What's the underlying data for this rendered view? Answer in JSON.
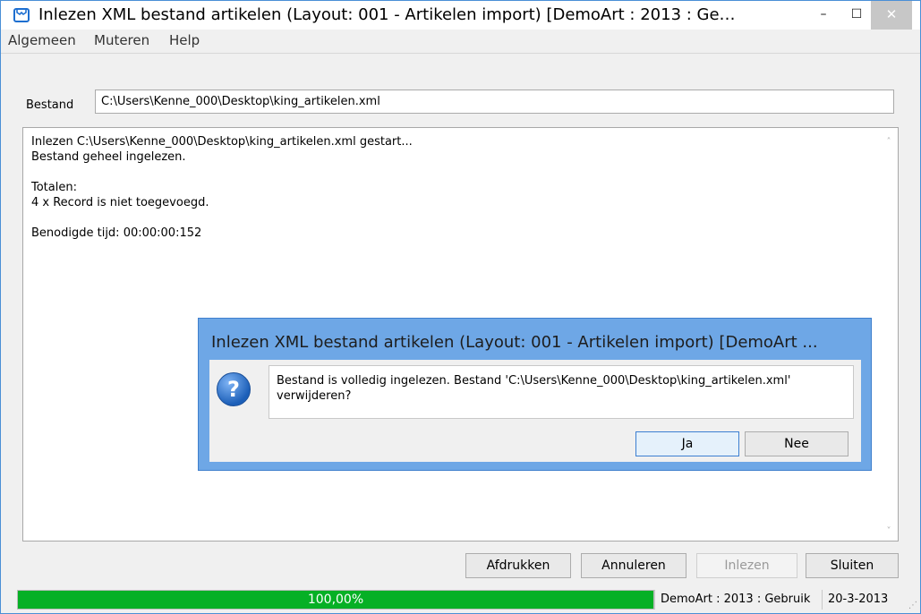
{
  "window": {
    "title": "Inlezen XML bestand artikelen (Layout: 001 - Artikelen import)  [DemoArt : 2013 : Ge…",
    "controls": {
      "minimize": "–",
      "maximize": "☐",
      "close": "✕"
    }
  },
  "menu": {
    "items": [
      "Algemeen",
      "Muteren",
      "Help"
    ]
  },
  "file": {
    "label": "Bestand",
    "value": "C:\\Users\\Kenne_000\\Desktop\\king_artikelen.xml"
  },
  "log": {
    "lines": [
      "Inlezen C:\\Users\\Kenne_000\\Desktop\\king_artikelen.xml gestart...",
      "Bestand geheel ingelezen.",
      "",
      "Totalen:",
      "4 x Record is niet toegevoegd.",
      "",
      "Benodigde tijd: 00:00:00:152"
    ]
  },
  "buttons": {
    "print": "Afdrukken",
    "cancel": "Annuleren",
    "import": "Inlezen",
    "close": "Sluiten"
  },
  "status": {
    "progress_text": "100,00%",
    "progress_fraction": 1.0,
    "context": "DemoArt : 2013 : Gebruik",
    "date": "20-3-2013"
  },
  "dialog": {
    "title": "Inlezen XML bestand artikelen (Layout: 001 - Artikelen import)  [DemoArt ...",
    "message": "Bestand is volledig ingelezen. Bestand 'C:\\Users\\Kenne_000\\Desktop\\king_artikelen.xml' verwijderen?",
    "icon": "question-icon",
    "yes": "Ja",
    "no": "Nee"
  },
  "colors": {
    "progress": "#06b025",
    "dialog_frame": "#6ea7e6",
    "app_icon": "#1e6fd0"
  }
}
